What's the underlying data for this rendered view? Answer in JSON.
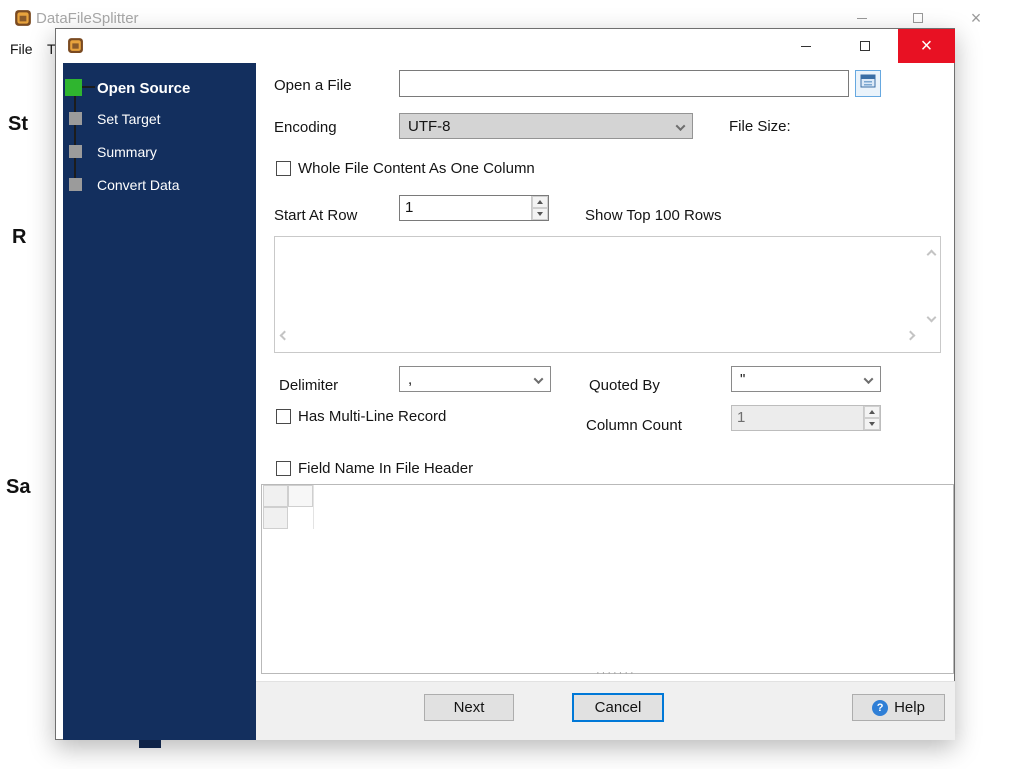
{
  "main_window": {
    "title": "DataFileSplitter",
    "menu_items": [
      "File",
      "T"
    ],
    "background_fragments": [
      "St",
      "R",
      "Sa"
    ]
  },
  "dialog": {
    "steps": [
      {
        "label": "Open Source",
        "active": true
      },
      {
        "label": "Set Target",
        "active": false
      },
      {
        "label": "Summary",
        "active": false
      },
      {
        "label": "Convert Data",
        "active": false
      }
    ],
    "fields": {
      "open_file_label": "Open a File",
      "open_file_value": "",
      "encoding_label": "Encoding",
      "encoding_value": "UTF-8",
      "file_size_label": "File Size:",
      "whole_file_label": "Whole File Content As One Column",
      "start_at_row_label": "Start At Row",
      "start_at_row_value": "1",
      "show_top_label": "Show Top 100 Rows",
      "delimiter_label": "Delimiter",
      "delimiter_value": ",",
      "quoted_by_label": "Quoted By",
      "quoted_by_value": "\"",
      "multiline_label": "Has Multi-Line Record",
      "column_count_label": "Column Count",
      "column_count_value": "1",
      "field_name_label": "Field Name In File Header"
    },
    "buttons": {
      "next": "Next",
      "cancel": "Cancel",
      "help": "Help",
      "help_icon": "?"
    },
    "colors": {
      "sidebar": "#132f5e",
      "active_step_green": "#2fb52f",
      "close_red": "#e81123",
      "focus_blue": "#0078d7"
    }
  }
}
